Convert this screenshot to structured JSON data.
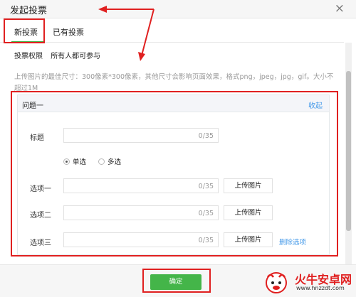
{
  "dialog": {
    "title": "发起投票",
    "close_glyph": "×"
  },
  "tabs": [
    {
      "label": "新投票"
    },
    {
      "label": "已有投票"
    }
  ],
  "permission": {
    "label": "投票权限",
    "value": "所有人都可参与"
  },
  "hint": "上传图片的最佳尺寸：300像素*300像素，其他尺寸会影响页面效果，格式png，jpeg，jpg，gif。大小不超过1M",
  "question": {
    "title": "问题一",
    "collapse_label": "收起",
    "title_field": {
      "label": "标题",
      "counter": "0/35"
    },
    "choice_single": "单选",
    "choice_multi": "多选",
    "options": [
      {
        "label": "选项一",
        "counter": "0/35",
        "upload_label": "上传图片"
      },
      {
        "label": "选项二",
        "counter": "0/35",
        "upload_label": "上传图片"
      },
      {
        "label": "选项三",
        "counter": "0/35",
        "upload_label": "上传图片",
        "delete_label": "删除选项"
      }
    ]
  },
  "footer": {
    "confirm_label": "确定"
  },
  "watermark": {
    "name": "火牛安卓网",
    "url": "www.hnzzdt.com"
  },
  "colors": {
    "accent_green": "#44b549",
    "link_blue": "#459ae9",
    "annotation_red": "#e02020"
  }
}
